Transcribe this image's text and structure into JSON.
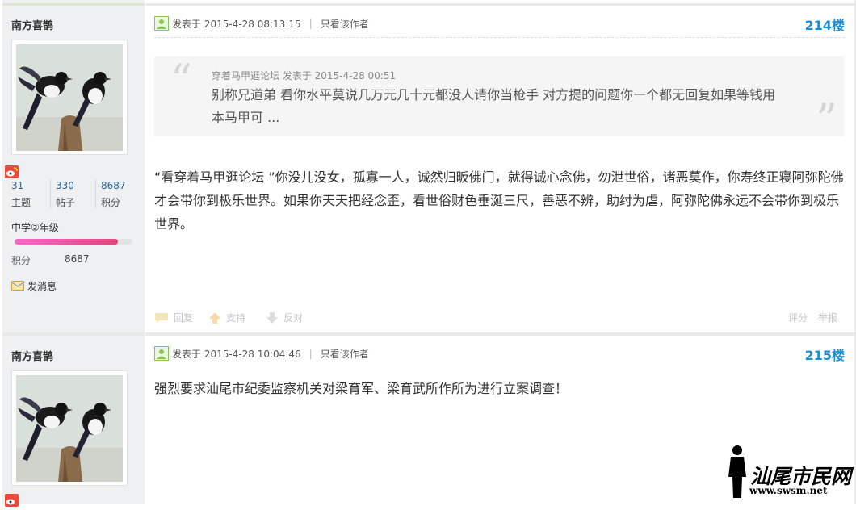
{
  "posts": [
    {
      "author": {
        "name": "南方喜鹊",
        "topics": "31",
        "topics_label": "主题",
        "threads": "330",
        "threads_label": "帖子",
        "points": "8687",
        "points_label": "积分",
        "level": "中学②年级",
        "level_progress": 0.88,
        "points_row_label": "积分",
        "points_row_value": "8687",
        "message_label": "发消息"
      },
      "meta": {
        "posted": "发表于 2015-4-28 08:13:15",
        "only_author": "只看该作者"
      },
      "floor": "214楼",
      "quote": {
        "head": "穿着马甲逛论坛 发表于 2015-4-28 00:51",
        "body": "别称兄道弟  看你水平莫说几万元几十元都没人请你当枪手  对方提的问题你一个都无回复如果等钱用本马甲可 ..."
      },
      "content": "“看穿着马甲逛论坛 ”你没儿没女，孤寡一人，诚然归昄佛门，就得诚心念佛，勿泄世俗，诸恶莫作，你寿终正寝阿弥陀佛才会带你到极乐世界。如果你天天把经念歪，看世俗财色垂涎三尺，善恶不辨，助纣为虐，阿弥陀佛永远不会带你到极乐世界。",
      "actions": {
        "reply": "回复",
        "support": "支持",
        "oppose": "反对",
        "rate": "评分",
        "report": "举报"
      }
    },
    {
      "author": {
        "name": "南方喜鹊"
      },
      "meta": {
        "posted": "发表于 2015-4-28 10:04:46",
        "only_author": "只看该作者"
      },
      "floor": "215楼",
      "content": "强烈要求汕尾市纪委监察机关对梁育军、梁育武所作所为进行立案调查！"
    }
  ],
  "watermark": {
    "title": "汕尾市民网",
    "url": "www.swsm.net"
  },
  "colors": {
    "floor": "#1a8fd6",
    "sidebar_bg": "#eef0f1",
    "level_bar": "#e0447c"
  },
  "icons": [
    "post-status-icon",
    "weibo-icon",
    "message-icon",
    "reply-icon",
    "support-icon",
    "oppose-icon"
  ]
}
